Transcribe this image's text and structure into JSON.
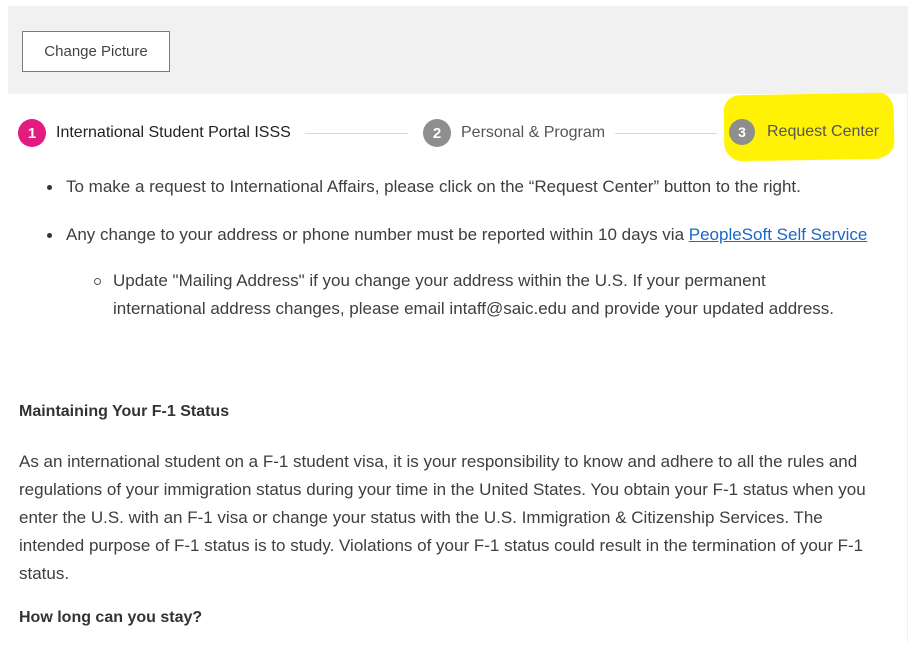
{
  "header": {
    "change_picture_label": "Change Picture"
  },
  "stepper": {
    "steps": [
      {
        "number": "1",
        "label": "International Student Portal ISSS"
      },
      {
        "number": "2",
        "label": "Personal & Program"
      },
      {
        "number": "3",
        "label": "Request Center"
      }
    ]
  },
  "content": {
    "bullets": {
      "first": "To make a request to International Affairs, please click on the “Request Center” button to the right.",
      "second_prefix": "Any change to your address or phone number must be reported within 10 days via ",
      "second_link": "PeopleSoft Self Service",
      "sub_item": "Update \"Mailing Address\" if you change your address within the U.S. If your permanent international address changes, please email intaff@saic.edu and provide your updated address."
    },
    "section_heading_1": "Maintaining Your F-1 Status",
    "paragraph_1": "As an international student on a F-1 student visa, it is your responsibility to know and adhere to all the rules and regulations of your immigration status during your time in the United States. You obtain your F-1 status when you enter the U.S. with an F-1 visa or change your status with the U.S. Immigration & Citizenship Services. The intended purpose of F-1 status is to study. Violations of your F-1 status could result in the termination of your F-1 status.",
    "section_heading_2": "How long can you stay?"
  },
  "colors": {
    "active_step": "#e31a80",
    "inactive_step": "#8e8e8e",
    "highlight": "#fff200",
    "link": "#1b66c9",
    "panel_background": "#f1f1f1"
  }
}
